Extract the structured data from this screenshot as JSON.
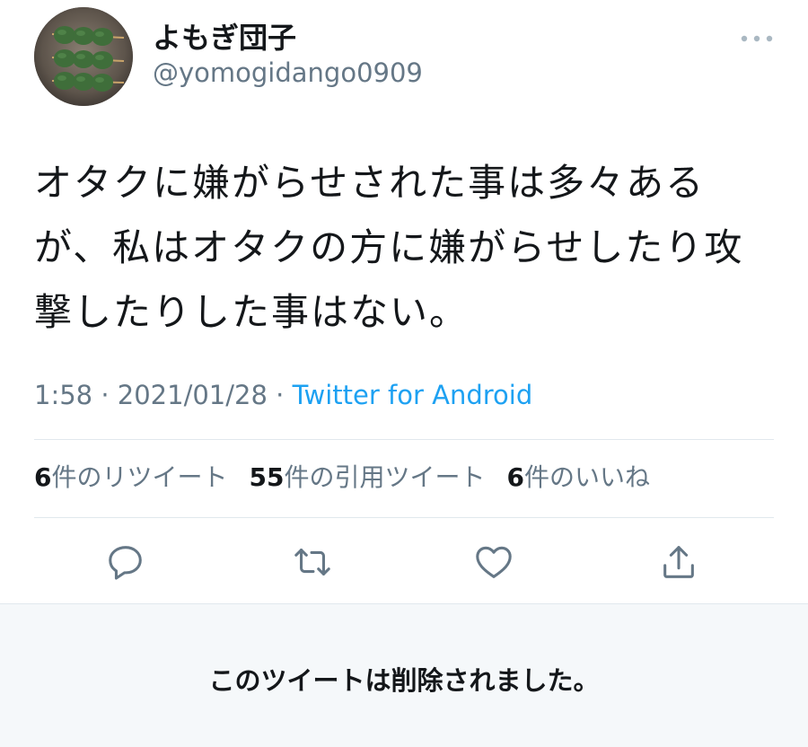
{
  "tweet": {
    "user": {
      "display_name": "よもぎ団子",
      "handle": "@yomogidango0909",
      "avatar_icon": "avatar-image-icon"
    },
    "text": "オタクに嫌がらせされた事は多々ある\nが、私はオタクの方に嫌がらせしたり攻\n撃したりした事はない。",
    "meta": {
      "time": "1:58",
      "separator": " · ",
      "date": "2021/01/28",
      "source": "Twitter for Android"
    },
    "stats": {
      "retweets_count": "6",
      "retweets_label": "件のリツイート",
      "quotes_count": "55",
      "quotes_label": "件の引用ツイート",
      "likes_count": "6",
      "likes_label": "件のいいね"
    },
    "actions": [
      {
        "name": "reply",
        "icon": "reply-icon"
      },
      {
        "name": "retweet",
        "icon": "retweet-icon"
      },
      {
        "name": "like",
        "icon": "heart-icon"
      },
      {
        "name": "share",
        "icon": "share-icon"
      }
    ]
  },
  "notice": {
    "deleted_text": "このツイートは削除されました。"
  },
  "colors": {
    "accent": "#1da1f2",
    "secondary_text": "#657786",
    "divider": "#e1e8ed",
    "notice_background": "#f5f8fa"
  }
}
